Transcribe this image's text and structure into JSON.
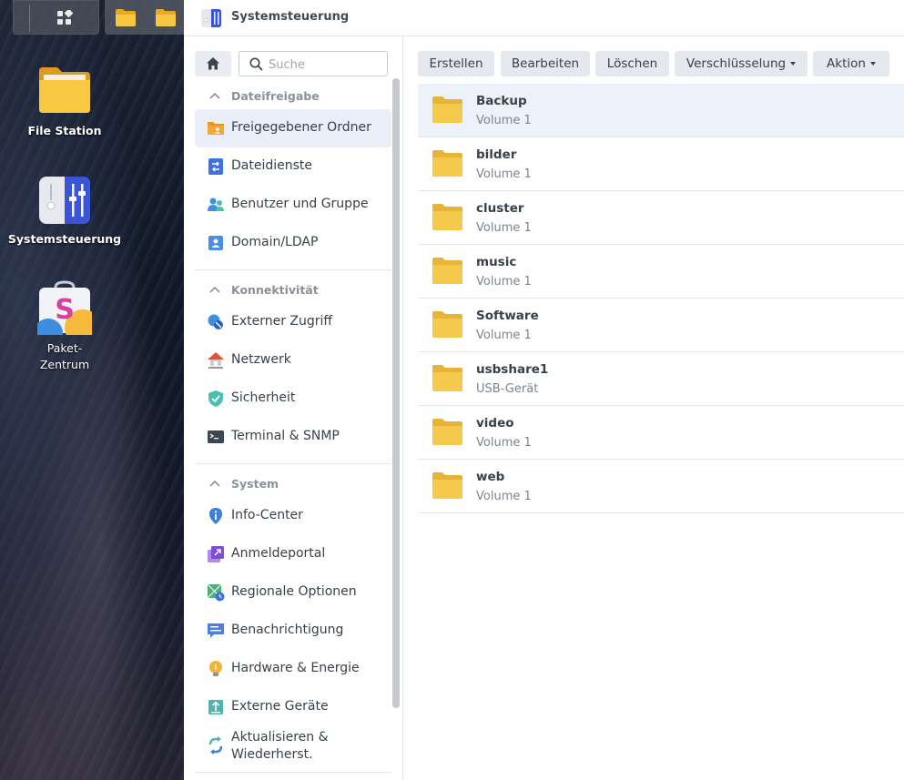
{
  "desktop": {
    "icons": [
      {
        "label": "File Station"
      },
      {
        "label": "Systemsteuerung"
      },
      {
        "label_line1": "Paket-",
        "label_line2": "Zentrum"
      }
    ]
  },
  "window": {
    "title": "Systemsteuerung"
  },
  "sidebar": {
    "search_placeholder": "Suche",
    "sections": [
      {
        "header": "Dateifreigabe",
        "items": [
          {
            "label": "Freigegebener Ordner",
            "active": true
          },
          {
            "label": "Dateidienste"
          },
          {
            "label": "Benutzer und Gruppe"
          },
          {
            "label": "Domain/LDAP"
          }
        ]
      },
      {
        "header": "Konnektivität",
        "items": [
          {
            "label": "Externer Zugriff"
          },
          {
            "label": "Netzwerk"
          },
          {
            "label": "Sicherheit"
          },
          {
            "label": "Terminal & SNMP"
          }
        ]
      },
      {
        "header": "System",
        "items": [
          {
            "label": "Info-Center"
          },
          {
            "label": "Anmeldeportal"
          },
          {
            "label": "Regionale Optionen"
          },
          {
            "label": "Benachrichtigung"
          },
          {
            "label": "Hardware & Energie"
          },
          {
            "label": "Externe Geräte"
          },
          {
            "label": "Aktualisieren & Wiederherst."
          }
        ]
      }
    ]
  },
  "toolbar": {
    "create": "Erstellen",
    "edit": "Bearbeiten",
    "delete": "Löschen",
    "encryption": "Verschlüsselung",
    "action": "Aktion"
  },
  "folders": [
    {
      "name": "Backup",
      "location": "Volume 1",
      "selected": true
    },
    {
      "name": "bilder",
      "location": "Volume 1"
    },
    {
      "name": "cluster",
      "location": "Volume 1"
    },
    {
      "name": "music",
      "location": "Volume 1"
    },
    {
      "name": "Software",
      "location": "Volume 1"
    },
    {
      "name": "usbshare1",
      "location": "USB-Gerät"
    },
    {
      "name": "video",
      "location": "Volume 1"
    },
    {
      "name": "web",
      "location": "Volume 1"
    }
  ],
  "colors": {
    "folder": "#f5c94c",
    "active_bg": "#e9eef8",
    "selected_row": "#edf1fa",
    "accent": "#4a6cf7"
  }
}
